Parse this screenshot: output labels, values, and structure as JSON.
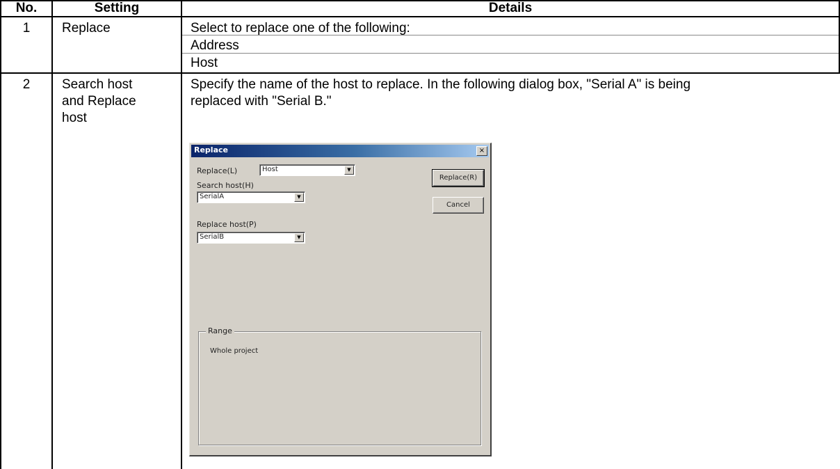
{
  "table": {
    "headers": [
      "No.",
      "Setting",
      "Details"
    ],
    "rows": [
      {
        "no": "1",
        "setting": "Replace",
        "details": [
          "Select to replace one of the following:",
          "Address",
          "Host"
        ]
      },
      {
        "no": "2",
        "setting": [
          "Search host",
          "and Replace",
          "host"
        ],
        "details": [
          "Specify the name of the host to replace. In the following dialog box, \"Serial A\" is being",
          "replaced with \"Serial B.\""
        ]
      }
    ]
  },
  "dialog": {
    "title": "Replace",
    "close_glyph": "×",
    "replace_label": "Replace(L)",
    "replace_value": "Host",
    "search_host_label": "Search host(H)",
    "search_host_value": "SerialA",
    "replace_host_label": "Replace host(P)",
    "replace_host_value": "SerialB",
    "replace_button": "Replace(R)",
    "cancel_button": "Cancel",
    "range_label": "Range",
    "range_value": "Whole project",
    "dropdown_arrow": "▼"
  }
}
